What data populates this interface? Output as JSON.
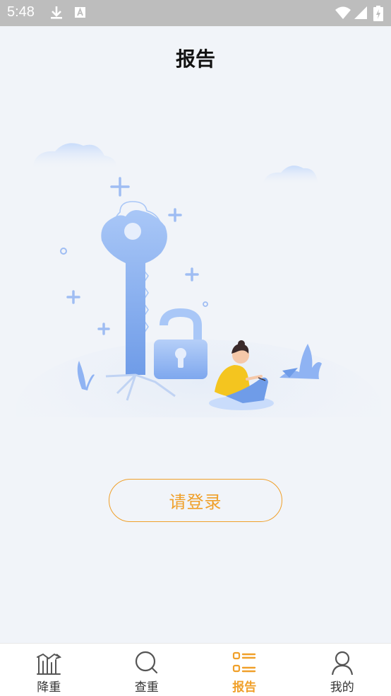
{
  "status_bar": {
    "time": "5:48",
    "icons": [
      "download-icon",
      "a-badge-icon",
      "wifi-icon",
      "signal-icon",
      "battery-icon"
    ]
  },
  "header": {
    "title": "报告"
  },
  "main": {
    "login_label": "请登录",
    "illustration": "key-and-lock-illustration"
  },
  "bottom_nav": {
    "items": [
      {
        "label": "降重",
        "icon": "chart-trend-icon",
        "active": false
      },
      {
        "label": "查重",
        "icon": "search-icon",
        "active": false
      },
      {
        "label": "报告",
        "icon": "list-icon",
        "active": true
      },
      {
        "label": "我的",
        "icon": "user-icon",
        "active": false
      }
    ]
  },
  "colors": {
    "accent": "#f0a02a",
    "background": "#f1f4f9",
    "status_bar": "#bdbdbd",
    "illustration_blue": "#8fb3f3"
  }
}
